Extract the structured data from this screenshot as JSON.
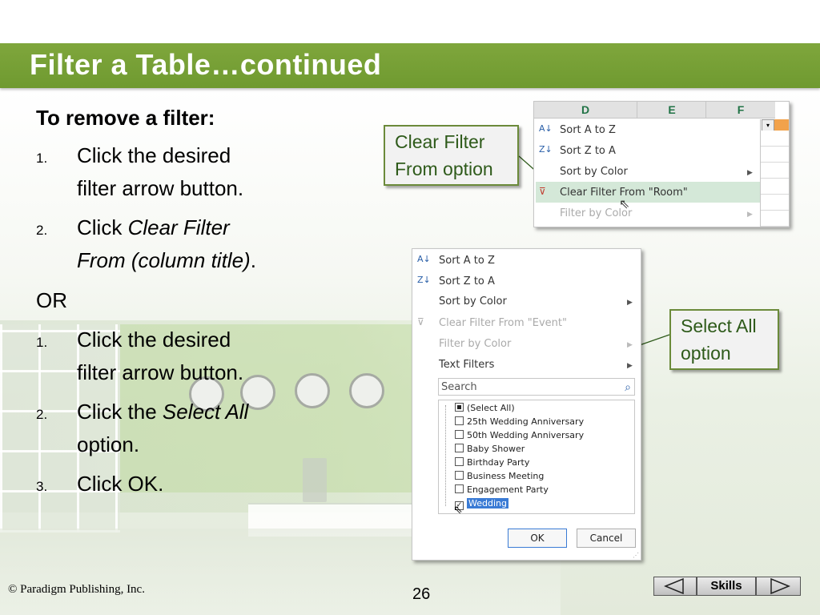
{
  "slide": {
    "title": "Filter a Table…continued",
    "heading": "To remove a filter:",
    "steps_a": [
      {
        "num": "1.",
        "line1": "Click the desired",
        "line2": "filter arrow button."
      },
      {
        "num": "2.",
        "line1_plain": "Click ",
        "line1_italic": "Clear Filter",
        "line2_italic": "From (column title)",
        "line2_end": "."
      }
    ],
    "or": "OR",
    "steps_b": [
      {
        "num": "1.",
        "line1": "Click the desired",
        "line2": "filter arrow button."
      },
      {
        "num": "2.",
        "line1_plain": "Click the ",
        "line1_italic": "Select All",
        "line2": "option."
      },
      {
        "num": "3.",
        "line1": "Click OK."
      }
    ]
  },
  "callouts": {
    "clear_filter": [
      "Clear Filter",
      "From option"
    ],
    "select_all": [
      "Select All",
      "option"
    ]
  },
  "excel_top": {
    "columns": [
      "D",
      "E",
      "F"
    ],
    "menu": [
      "Sort A to Z",
      "Sort Z to A",
      "Sort by Color",
      "Clear Filter From \"Room\"",
      "Filter by Color"
    ]
  },
  "excel_dialog": {
    "menu": [
      "Sort A to Z",
      "Sort Z to A",
      "Sort by Color",
      "Clear Filter From \"Event\"",
      "Filter by Color",
      "Text Filters"
    ],
    "search_placeholder": "Search",
    "items": [
      "(Select All)",
      "25th Wedding Anniversary",
      "50th Wedding Anniversary",
      "Baby Shower",
      "Birthday Party",
      "Business Meeting",
      "Engagement Party",
      "Wedding"
    ],
    "ok": "OK",
    "cancel": "Cancel"
  },
  "footer": {
    "copyright": "© Paradigm Publishing, Inc.",
    "page": "26",
    "skills": "Skills"
  },
  "colors": {
    "title_bar": "#77a037",
    "callout_border": "#6b8a3a",
    "highlight": "#d4e8d8"
  }
}
